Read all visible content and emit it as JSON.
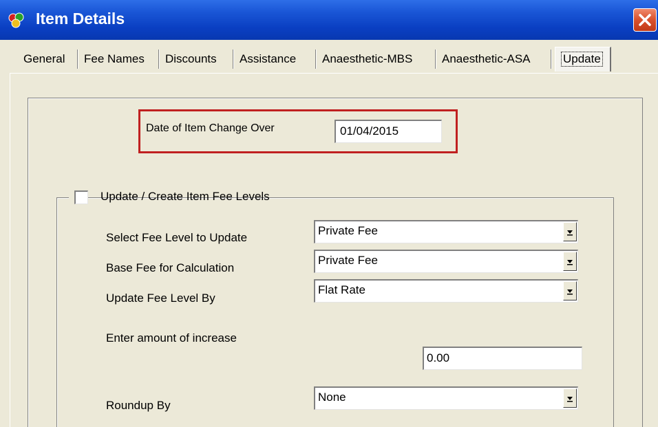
{
  "window": {
    "title": "Item Details",
    "app_icon": "rings-app-icon",
    "close_icon": "close-icon",
    "titlebar_color": "#0a3fc2",
    "close_color": "#d9502c"
  },
  "tabs": [
    {
      "label": "General"
    },
    {
      "label": "Fee Names"
    },
    {
      "label": "Discounts"
    },
    {
      "label": "Assistance"
    },
    {
      "label": "Anaesthetic-MBS"
    },
    {
      "label": "Anaesthetic-ASA"
    },
    {
      "label": "Update",
      "active": true
    }
  ],
  "changeover": {
    "label": "Date of Item Change Over",
    "value": "01/04/2015",
    "highlight_color": "#c02020"
  },
  "fee_group": {
    "title": "Update / Create Item Fee Levels",
    "checked": false,
    "select_level_label": "Select Fee Level to Update",
    "select_level_value": "Private Fee",
    "base_fee_label": "Base Fee for Calculation",
    "base_fee_value": "Private Fee",
    "update_by_label": "Update Fee Level By",
    "update_by_value": "Flat Rate",
    "increase_label": "Enter amount of increase",
    "increase_value": "0.00",
    "roundup_label": "Roundup By",
    "roundup_value": "None"
  }
}
